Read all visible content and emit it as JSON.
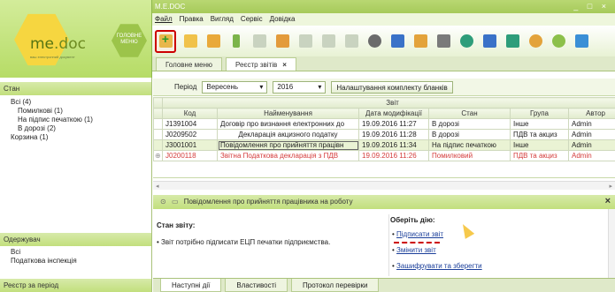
{
  "logo": {
    "brand_me": "me",
    "brand_doc": ".doc",
    "tagline": "ваш електронний документ",
    "menu_btn": "ГОЛОВНЕ МЕНЮ"
  },
  "window": {
    "title": "M.E.DOC",
    "controls": "_ □ ×"
  },
  "menu": [
    "Файл",
    "Правка",
    "Вигляд",
    "Сервіс",
    "Довідка"
  ],
  "tabs": [
    {
      "label": "Головне меню"
    },
    {
      "label": "Реєстр звітів",
      "close": "×"
    }
  ],
  "sidebar": {
    "stan_header": "Стан",
    "stan_items": [
      "Всі (4)",
      "Помилкові (1)",
      "На підпис печаткою (1)",
      "В дорозі (2)",
      "Корзина (1)"
    ],
    "receiver_header": "Одержувач",
    "receiver_items": [
      "Всі",
      "Податкова інспекція"
    ],
    "period_header": "Реєстр за період"
  },
  "filter": {
    "period_label": "Період",
    "month": "Вересень",
    "year": "2016",
    "settings_btn": "Налаштування комплекту бланків"
  },
  "table": {
    "group_header": "Звіт",
    "columns": [
      "Код",
      "Найменування",
      "Дата модифікації",
      "Стан",
      "Група",
      "Автор"
    ],
    "rows": [
      [
        "J1391004",
        "Договір про визнання електронних до",
        "19.09.2016 11:27",
        "В дорозі",
        "Інше",
        "Admin"
      ],
      [
        "J0209502",
        "Декларація акцизного податку",
        "19.09.2016 11:28",
        "В дорозі",
        "ПДВ та акциз",
        "Admin"
      ],
      [
        "J3001001",
        "Повідомлення про прийняття працівн",
        "19.09.2016 11:34",
        "На підпис печаткою",
        "Інше",
        "Admin"
      ],
      [
        "J0200118",
        "Звітна Податкова декларація з ПДВ",
        "19.09.2016 11:26",
        "Помилковий",
        "ПДВ та акциз",
        "Admin"
      ]
    ]
  },
  "detail": {
    "title": "Повідомлення про прийняття працівника на роботу",
    "close": "×",
    "state_label": "Стан звіту:",
    "state_text": "Звіт потрібно підписати ЕЦП печатки підприємства.",
    "action_label": "Оберіть дію:",
    "actions": [
      "Підписати звіт",
      "Змінити звіт",
      "Зашифрувати та зберегти"
    ]
  },
  "bottom_tabs": [
    "Наступні дії",
    "Властивості",
    "Протокол перевірки"
  ],
  "colors": {
    "accent_green": "#b6dc66",
    "error_red": "#d43b3b",
    "highlight_box": "#cc0000"
  }
}
